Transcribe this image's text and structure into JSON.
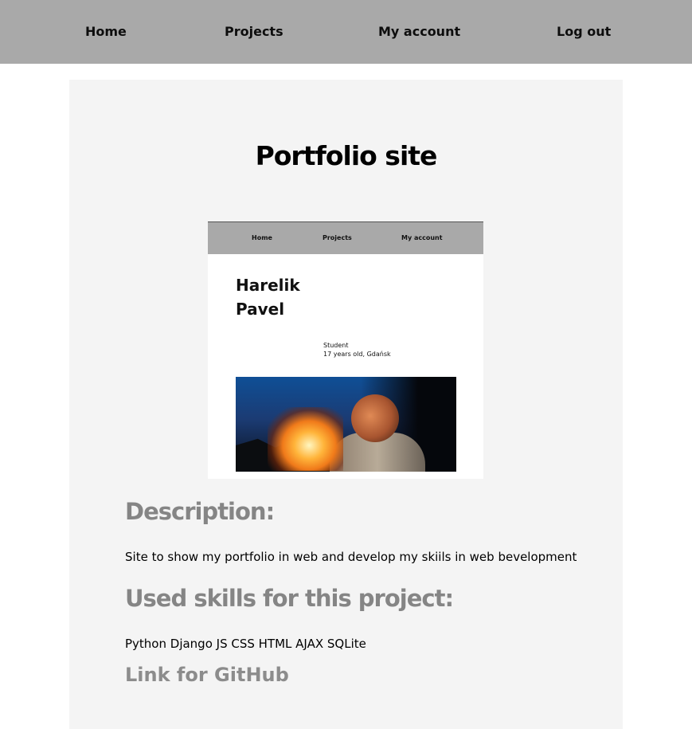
{
  "nav": {
    "home": "Home",
    "projects": "Projects",
    "my_account": "My account",
    "log_out": "Log out"
  },
  "project": {
    "title": "Portfolio site",
    "description_heading": "Description:",
    "description": "Site to show my portfolio in web and develop my skiils in web bevelopment",
    "skills_heading": "Used skills for this project:",
    "skills": "Python Django JS CSS HTML AJAX SQLite",
    "github_link": "Link for GitHub"
  },
  "preview": {
    "nav": {
      "home": "Home",
      "projects": "Projects",
      "my_account": "My account"
    },
    "first_name": "Harelik",
    "last_name": "Pavel",
    "role": "Student",
    "age_city": "17 years old, Gdańsk"
  },
  "colors": {
    "nav_bg": "#a9a9a9",
    "card_bg": "#f4f4f4",
    "heading_gray": "#858585"
  }
}
